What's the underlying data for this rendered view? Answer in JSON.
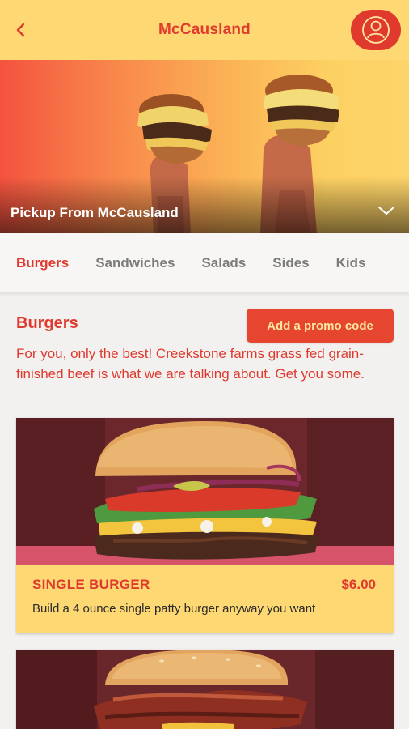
{
  "header": {
    "title": "McCausland"
  },
  "hero": {
    "pickup_label": "Pickup From McCausland"
  },
  "tabs": [
    {
      "label": "Burgers",
      "active": true
    },
    {
      "label": "Sandwiches",
      "active": false
    },
    {
      "label": "Salads",
      "active": false
    },
    {
      "label": "Sides",
      "active": false
    },
    {
      "label": "Kids",
      "active": false
    }
  ],
  "section": {
    "title": "Burgers",
    "promo_button": "Add a promo code",
    "description": "For you, only the best! Creekstone farms grass fed grain-finished beef is what we are talking about. Get you some."
  },
  "items": [
    {
      "name": "SINGLE BURGER",
      "price": "$6.00",
      "description": "Build a 4 ounce single patty burger anyway you want"
    }
  ],
  "colors": {
    "brand_red": "#e03a2f",
    "brand_yellow": "#fed873"
  },
  "icons": {
    "back": "chevron-left-icon",
    "profile": "user-icon",
    "pickup": "chevron-down-icon"
  }
}
